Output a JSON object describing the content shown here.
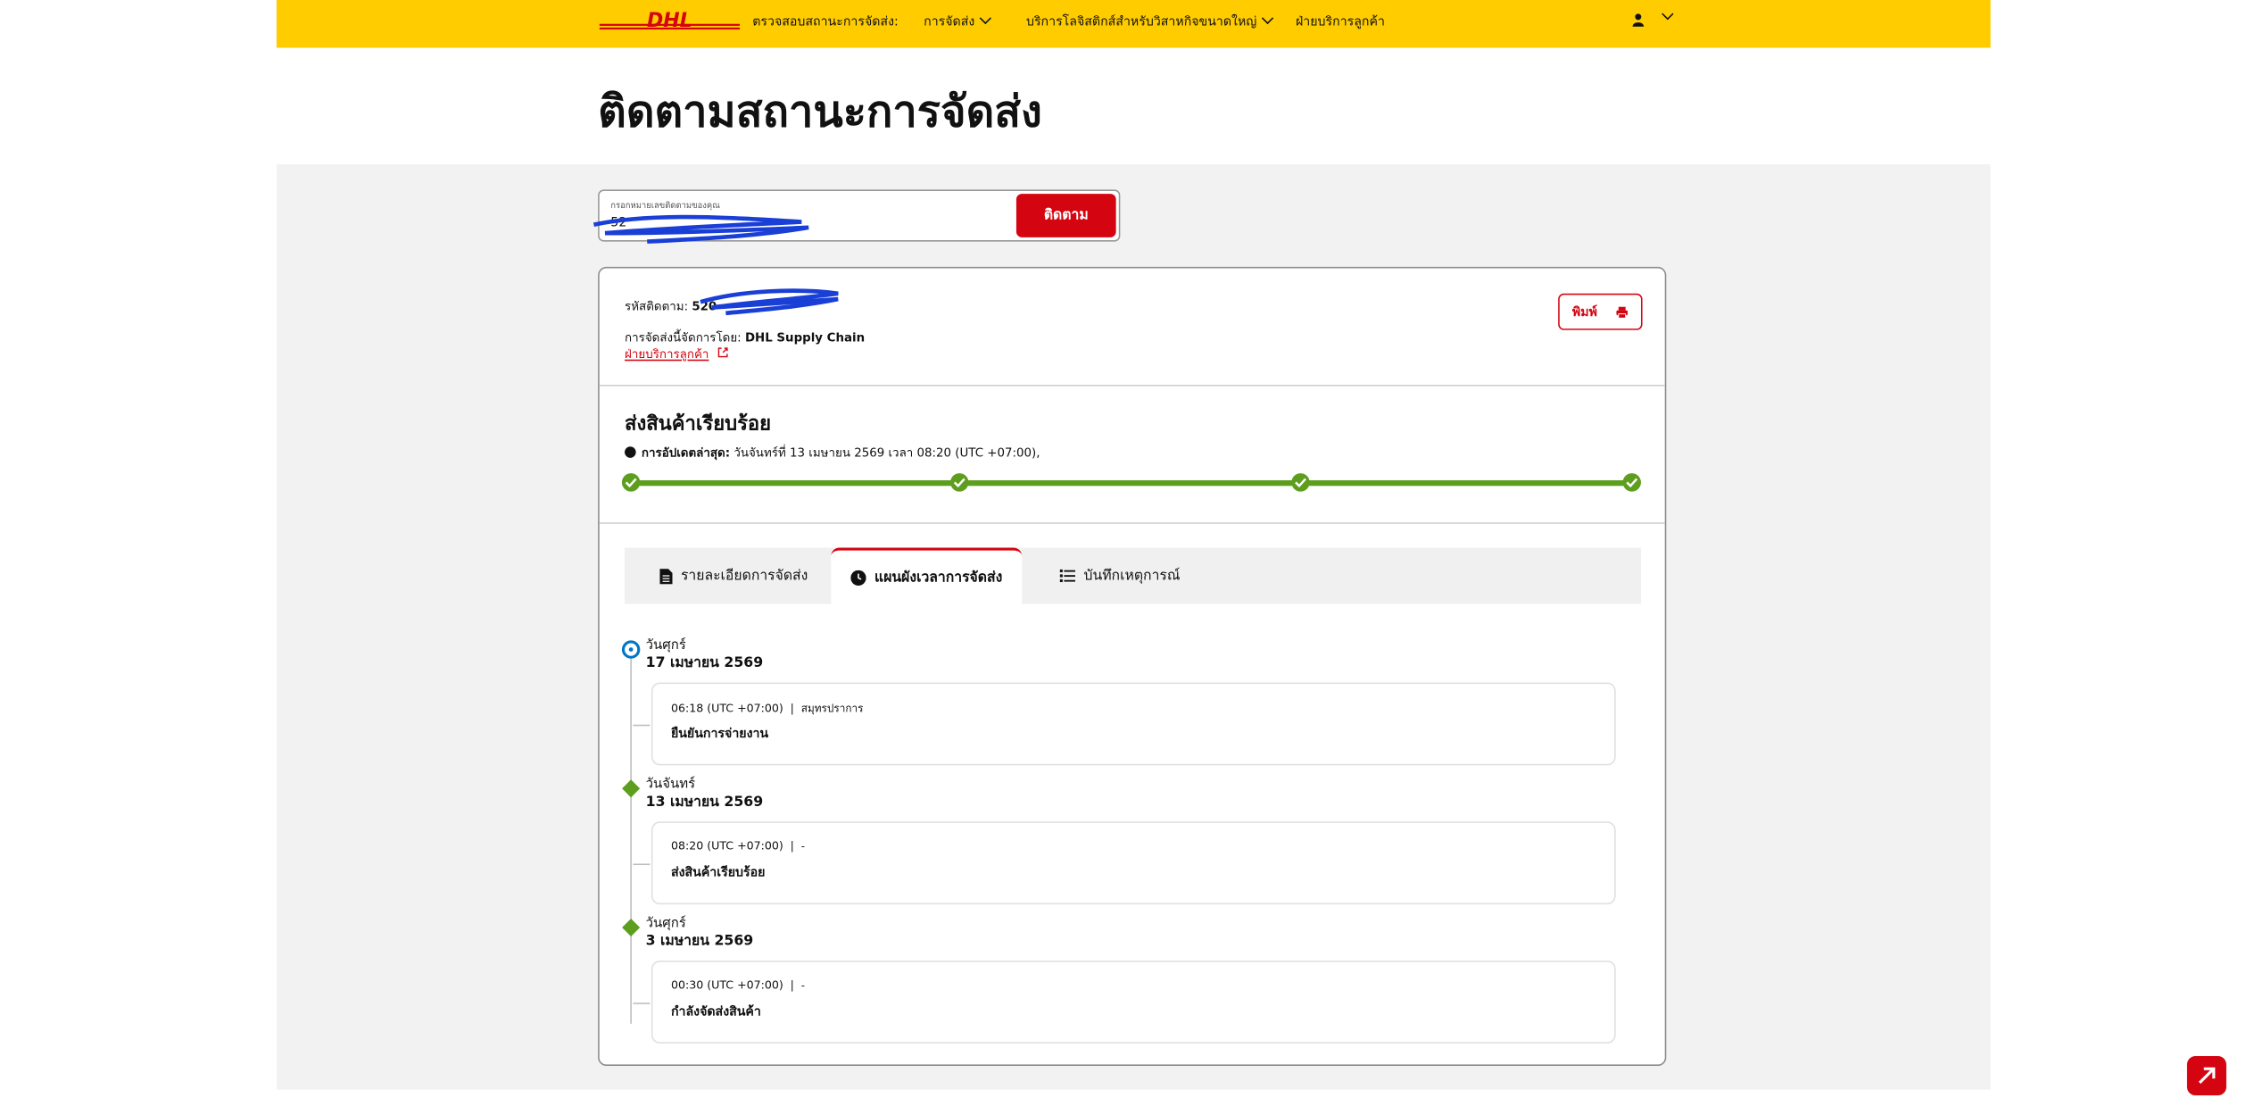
{
  "header": {
    "logo_text": "DHL",
    "nav": [
      {
        "label": "ตรวจสอบสถานะการจัดส่ง:"
      },
      {
        "label": "การจัดส่ง"
      },
      {
        "label": "บริการโลจิสติกส์สำหรับวิสาหกิจขนาดใหญ่"
      },
      {
        "label": "ฝ่ายบริการลูกค้า"
      }
    ],
    "brand_yellow": "#ffcc00",
    "brand_red": "#d40511"
  },
  "page_title": "ติดตามสถานะการจัดส่ง",
  "search": {
    "label": "กรอกหมายเลขติดตามของคุณ",
    "value": "52",
    "button_label": "ติดตาม"
  },
  "shipment": {
    "tracking_label": "รหัสติดตาม:",
    "tracking_value": "520",
    "handled_label": "การจัดส่งนี้จัดการโดย:",
    "handled_value": "DHL Supply Chain",
    "customer_link": "ฝ่ายบริการลูกค้า",
    "print_label": "พิมพ์"
  },
  "status": {
    "title": "ส่งสินค้าเรียบร้อย",
    "update_label": "การอัปเดตล่าสุด:",
    "update_value": "วันจันทร์ที่ 13 เมษายน 2569 เวลา 08:20 (UTC +07:00),",
    "progress_steps_done": 4,
    "progress_steps_total": 4
  },
  "tabs": [
    {
      "label": "รายละเอียดการจัดส่ง",
      "icon": "document-icon",
      "active": false
    },
    {
      "label": "แผนผังเวลาการจัดส่ง",
      "icon": "clock-icon",
      "active": true
    },
    {
      "label": "บันทึกเหตุการณ์",
      "icon": "list-icon",
      "active": false
    }
  ],
  "timeline": [
    {
      "day": "วันศุกร์",
      "date": "17 เมษายน 2569",
      "time": "06:18 (UTC +07:00)",
      "separator": "|",
      "location": "สมุทรปราการ",
      "event": "ยืนยันการจ่ายงาน",
      "marker": "current"
    },
    {
      "day": "วันจันทร์",
      "date": "13 เมษายน 2569",
      "time": "08:20 (UTC +07:00)",
      "separator": "|",
      "location": "-",
      "event": "ส่งสินค้าเรียบร้อย",
      "marker": "done"
    },
    {
      "day": "วันศุกร์",
      "date": "3 เมษายน 2569",
      "time": "00:30 (UTC +07:00)",
      "separator": "|",
      "location": "-",
      "event": "กำลังจัดส่งสินค้า",
      "marker": "done"
    }
  ]
}
